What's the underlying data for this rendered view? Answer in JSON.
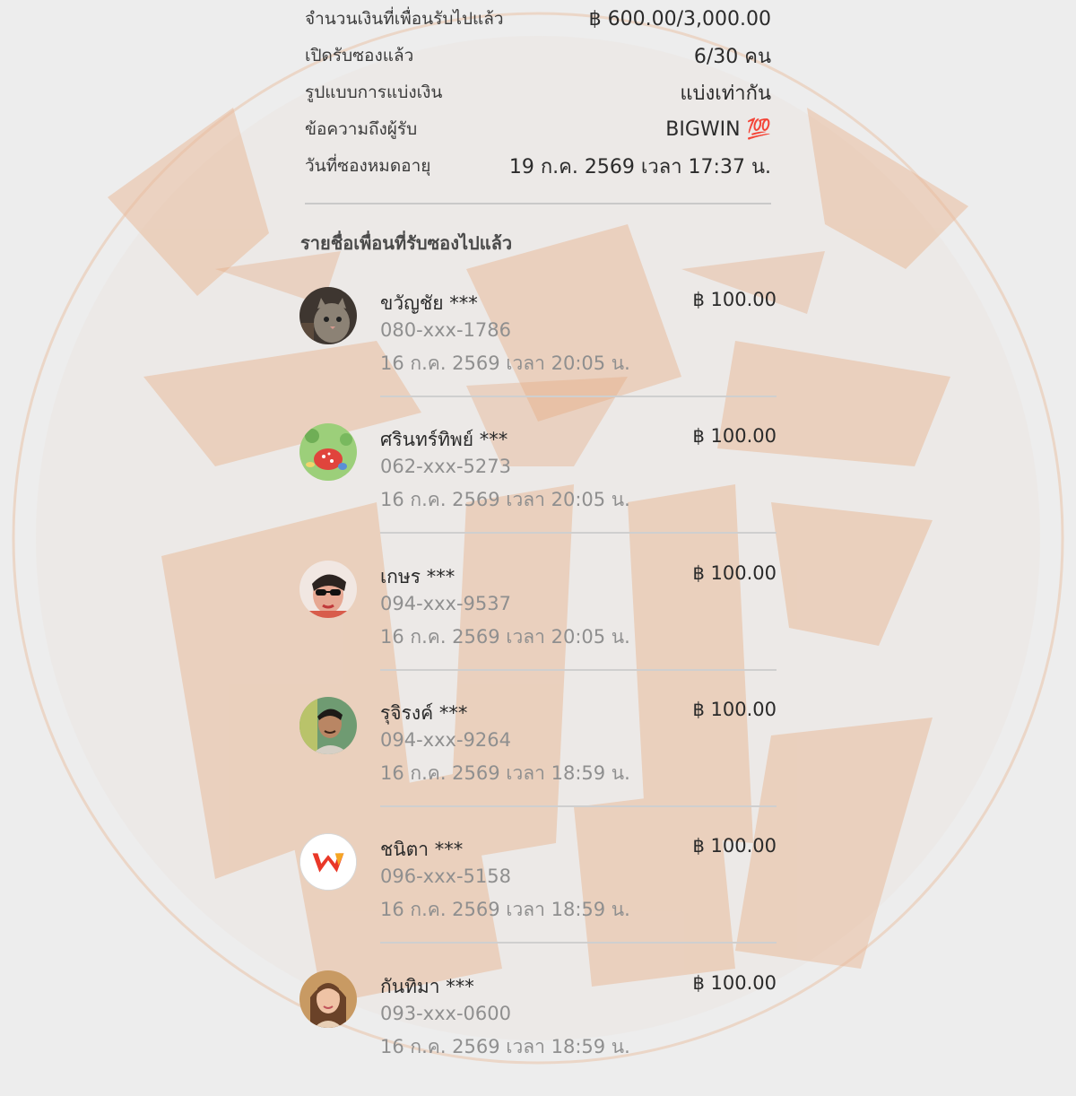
{
  "summary": {
    "rows": [
      {
        "label": "จำนวนเงินที่เพื่อนรับไปแล้ว",
        "value": "฿ 600.00/3,000.00"
      },
      {
        "label": "เปิดรับซองแล้ว",
        "value": "6/30 คน"
      },
      {
        "label": "รูปแบบการแบ่งเงิน",
        "value": "แบ่งเท่ากัน"
      },
      {
        "label": "ข้อความถึงผู้รับ",
        "value": "BIGWIN 💯"
      },
      {
        "label": "วันที่ซองหมดอายุ",
        "value": "19 ก.ค. 2569 เวลา 17:37 น."
      }
    ]
  },
  "recipients_section": {
    "title": "รายชื่อเพื่อนที่รับซองไปแล้ว",
    "items": [
      {
        "name": "ขวัญชัย ***",
        "phone": "080-xxx-1786",
        "time": "16 ก.ค. 2569 เวลา 20:05 น.",
        "amount": "฿ 100.00",
        "avatar": "cat-photo"
      },
      {
        "name": "ศรินทร์ทิพย์ ***",
        "phone": "062-xxx-5273",
        "time": "16 ก.ค. 2569 เวลา 20:05 น.",
        "amount": "฿ 100.00",
        "avatar": "cartoon-garden"
      },
      {
        "name": "เกษร ***",
        "phone": "094-xxx-9537",
        "time": "16 ก.ค. 2569 เวลา 20:05 น.",
        "amount": "฿ 100.00",
        "avatar": "woman-sunglasses"
      },
      {
        "name": "รุจิรงค์ ***",
        "phone": "094-xxx-9264",
        "time": "16 ก.ค. 2569 เวลา 18:59 น.",
        "amount": "฿ 100.00",
        "avatar": "man-portrait"
      },
      {
        "name": "ชนิตา ***",
        "phone": "096-xxx-5158",
        "time": "16 ก.ค. 2569 เวลา 18:59 น.",
        "amount": "฿ 100.00",
        "avatar": "w-logo"
      },
      {
        "name": "กันทิมา ***",
        "phone": "093-xxx-0600",
        "time": "16 ก.ค. 2569 เวลา 18:59 น.",
        "amount": "฿ 100.00",
        "avatar": "woman-portrait"
      }
    ]
  },
  "colors": {
    "background": "#ededed",
    "watermark": "#e7b48f",
    "text_primary": "#2a2a2a",
    "text_secondary": "#8f8f8f",
    "divider": "#cfcfcf"
  }
}
